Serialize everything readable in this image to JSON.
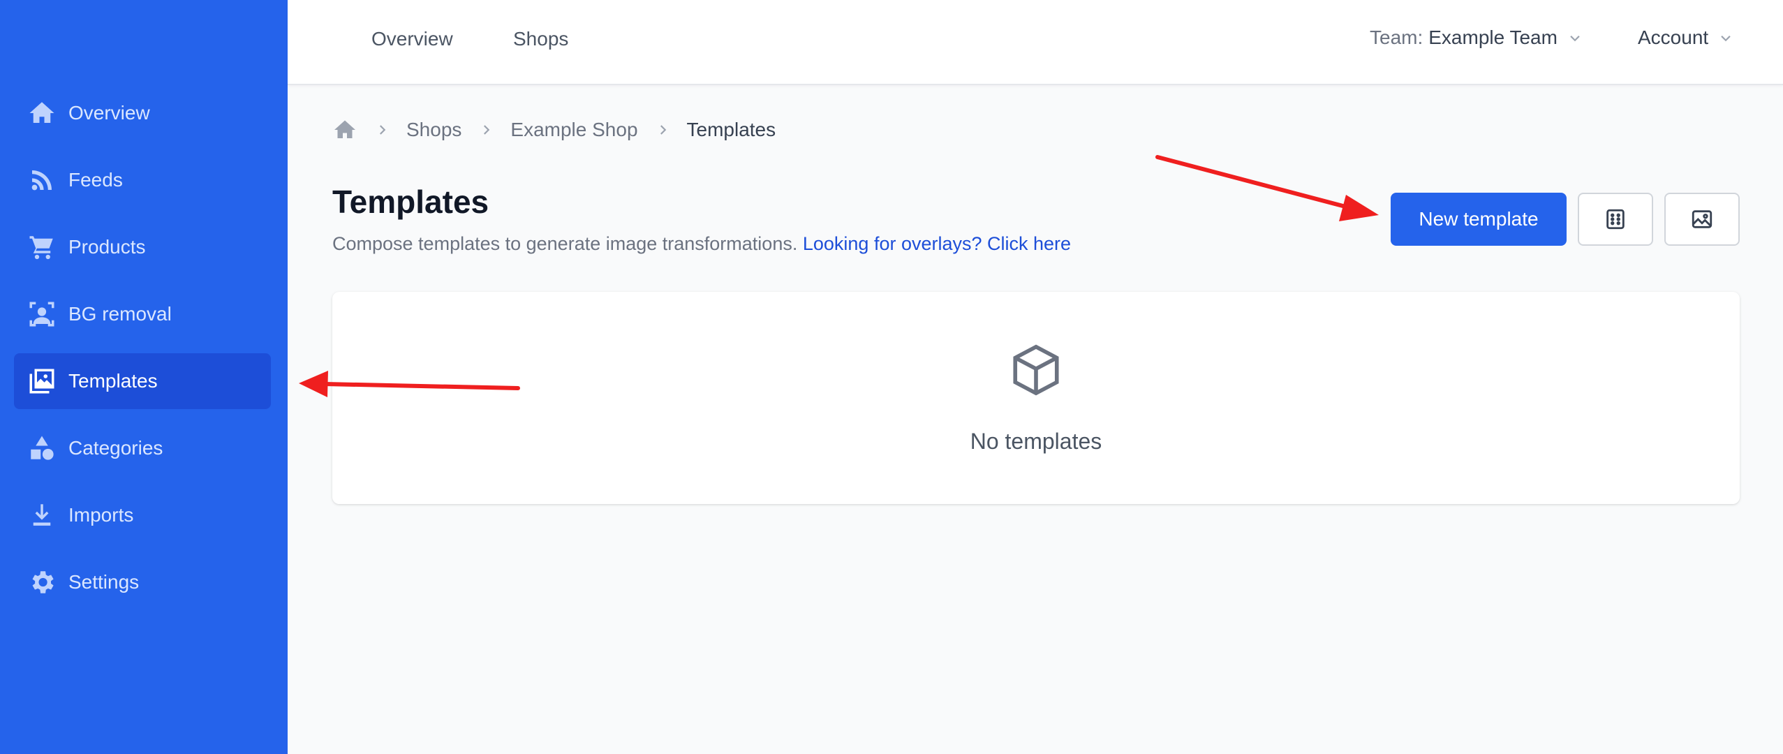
{
  "sidebar": {
    "items": [
      {
        "label": "Overview",
        "icon": "home-icon"
      },
      {
        "label": "Feeds",
        "icon": "rss-icon"
      },
      {
        "label": "Products",
        "icon": "cart-icon"
      },
      {
        "label": "BG removal",
        "icon": "person-bg-icon"
      },
      {
        "label": "Templates",
        "icon": "collection-image-icon",
        "active": true
      },
      {
        "label": "Categories",
        "icon": "shapes-icon"
      },
      {
        "label": "Imports",
        "icon": "download-icon"
      },
      {
        "label": "Settings",
        "icon": "gear-icon"
      }
    ]
  },
  "topbar": {
    "nav": [
      "Overview",
      "Shops"
    ],
    "team_label": "Team:",
    "team_value": "Example Team",
    "account": "Account"
  },
  "breadcrumb": [
    "Shops",
    "Example Shop",
    "Templates"
  ],
  "page": {
    "title": "Templates",
    "subtitle": "Compose templates to generate image transformations.",
    "subtitle_link": "Looking for overlays? Click here",
    "new_button": "New template",
    "icon_buttons": [
      "grid-icon",
      "image-icon"
    ]
  },
  "empty_state": {
    "icon": "cube-icon",
    "message": "No templates"
  },
  "colors": {
    "sidebar": "#2563eb",
    "sidebar_active": "#1d4ed8",
    "primary": "#2563eb",
    "annotation_arrow": "#ef1f1f"
  }
}
